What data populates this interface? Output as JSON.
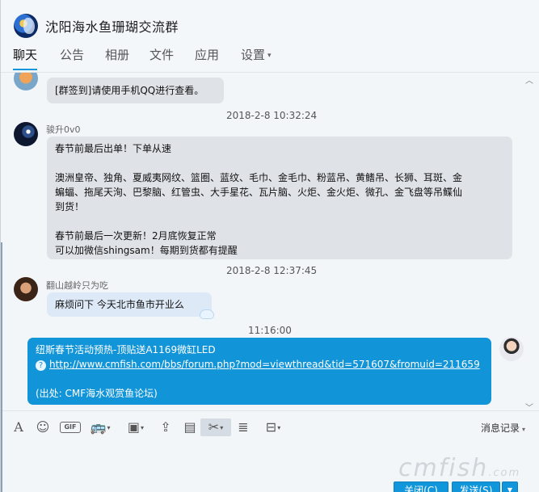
{
  "header": {
    "group_name": "沈阳海水鱼珊瑚交流群",
    "tabs": [
      {
        "label": "聊天",
        "active": true
      },
      {
        "label": "公告",
        "active": false
      },
      {
        "label": "相册",
        "active": false
      },
      {
        "label": "文件",
        "active": false
      },
      {
        "label": "应用",
        "active": false
      },
      {
        "label": "设置",
        "active": false
      }
    ],
    "settings_caret": "▾"
  },
  "messages": {
    "m1": {
      "text": "[群签到]请使用手机QQ进行查看。"
    },
    "ts1": "2018-2-8 10:32:24",
    "m2": {
      "sender": "骏升0v0",
      "lines": [
        "春节前最后出单！下单从速",
        "",
        "澳洲皇帝、独角、夏威夷网纹、篮圈、蓝纹、毛巾、金毛巾、粉蓝吊、黄鳍吊、长狮、耳斑、金",
        "蝙蝠、拖尾天洵、巴黎脑、红管虫、大手星花、瓦片脑、火炬、金火炬、微孔、金飞盘等吊鲽仙",
        "到货！",
        "",
        "春节前最后一次更新！2月底恢复正常",
        "可以加微信shingsam！每期到货都有提醒"
      ]
    },
    "ts2": "2018-2-8 12:37:45",
    "m3": {
      "sender": "翻山越岭只为吃",
      "text": "麻烦问下  今天北市鱼市开业么"
    },
    "ts3": "11:16:00",
    "m4": {
      "title": "纽斯春节活动预热-顶贴送A1169微缸LED",
      "link": "http://www.cmfish.com/bbs/forum.php?mod=viewthread&tid=571607&fromuid=211659",
      "source": "(出处: CMF海水观赏鱼论坛)"
    }
  },
  "toolbar": {
    "font": "A",
    "gif": "GIF",
    "message_history": "消息记录"
  },
  "footer": {
    "watermark": "cmfish",
    "watermark_suffix": ".com",
    "close_button": "关闭(C)",
    "send_button": "发送(S)",
    "send_options": "▼"
  },
  "colors": {
    "accent": "#1296db",
    "self_bubble": "#1294d8",
    "other_bubble": "#dfe3e8"
  }
}
